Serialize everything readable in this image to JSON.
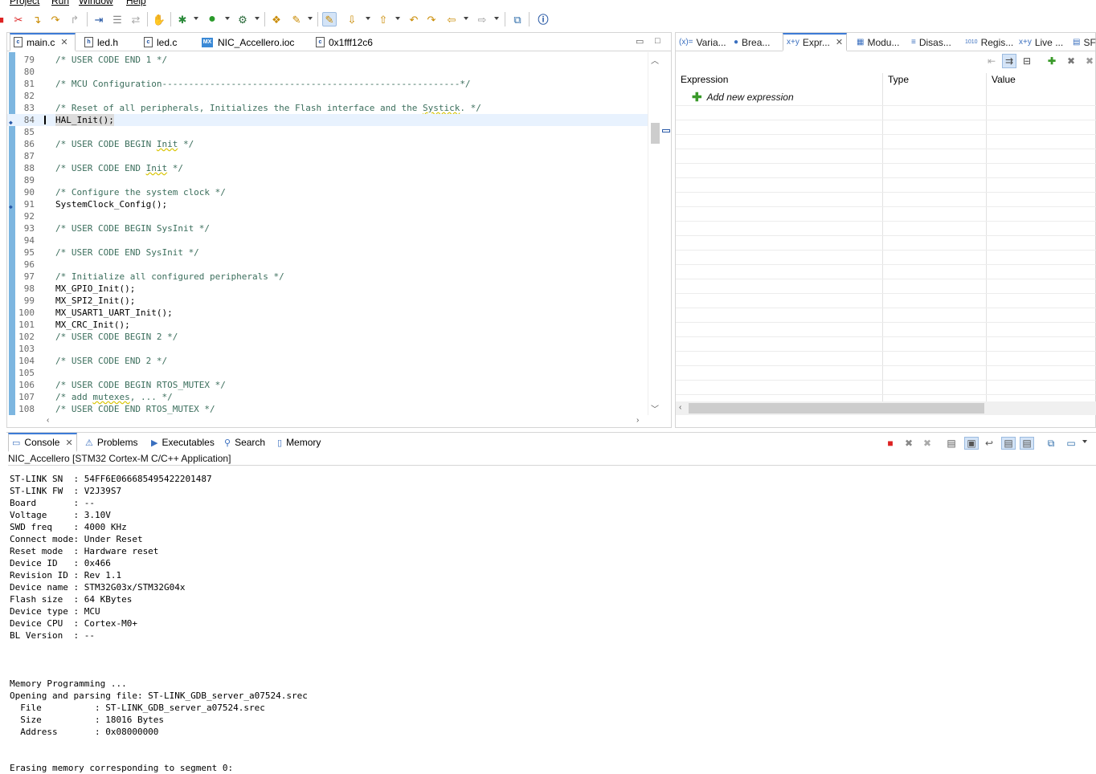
{
  "menu": {
    "items": [
      "Project",
      "Run",
      "Window",
      "Help"
    ]
  },
  "toolbar": {
    "icons": [
      "terminate-icon",
      "disconnect-icon",
      "step-return-icon",
      "use-step-filters-icon",
      "step-into-icon",
      "drop-to-frame-icon",
      "debug-icon",
      "run-icon",
      "external-tools-icon",
      "open-type-icon",
      "build-icon",
      "toggle-mark-occurrences-icon",
      "next-annotation-icon",
      "previous-annotation-icon",
      "last-edit-location-icon",
      "back-icon",
      "forward-icon",
      "open-perspective-icon",
      "info-icon"
    ]
  },
  "editor": {
    "tabs": [
      {
        "label": "main.c",
        "icon": "c"
      },
      {
        "label": "led.h",
        "icon": "h"
      },
      {
        "label": "led.c",
        "icon": "c"
      },
      {
        "label": "NIC_Accellero.ioc",
        "icon": "MX"
      },
      {
        "label": "0x1fff12c6",
        "icon": "c"
      }
    ],
    "lines": [
      {
        "n": "79",
        "t": "/* USER CODE END 1 */"
      },
      {
        "n": "80",
        "t": ""
      },
      {
        "n": "81",
        "t": "/* MCU Configuration--------------------------------------------------------*/"
      },
      {
        "n": "82",
        "t": ""
      },
      {
        "n": "83",
        "t": "/* Reset of all peripherals, Initializes the Flash interface and the Systick. */"
      },
      {
        "n": "84",
        "t": "HAL_Init();"
      },
      {
        "n": "85",
        "t": ""
      },
      {
        "n": "86",
        "t": "/* USER CODE BEGIN Init */"
      },
      {
        "n": "87",
        "t": ""
      },
      {
        "n": "88",
        "t": "/* USER CODE END Init */"
      },
      {
        "n": "89",
        "t": ""
      },
      {
        "n": "90",
        "t": "/* Configure the system clock */"
      },
      {
        "n": "91",
        "t": "SystemClock_Config();"
      },
      {
        "n": "92",
        "t": ""
      },
      {
        "n": "93",
        "t": "/* USER CODE BEGIN SysInit */"
      },
      {
        "n": "94",
        "t": ""
      },
      {
        "n": "95",
        "t": "/* USER CODE END SysInit */"
      },
      {
        "n": "96",
        "t": ""
      },
      {
        "n": "97",
        "t": "/* Initialize all configured peripherals */"
      },
      {
        "n": "98",
        "t": "MX_GPIO_Init();"
      },
      {
        "n": "99",
        "t": "MX_SPI2_Init();"
      },
      {
        "n": "100",
        "t": "MX_USART1_UART_Init();"
      },
      {
        "n": "101",
        "t": "MX_CRC_Init();"
      },
      {
        "n": "102",
        "t": "/* USER CODE BEGIN 2 */"
      },
      {
        "n": "103",
        "t": ""
      },
      {
        "n": "104",
        "t": "/* USER CODE END 2 */"
      },
      {
        "n": "105",
        "t": ""
      },
      {
        "n": "106",
        "t": "/* USER CODE BEGIN RTOS_MUTEX */"
      },
      {
        "n": "107",
        "t": "/* add mutexes, ... */"
      },
      {
        "n": "108",
        "t": "/* USER CODE END RTOS_MUTEX */"
      }
    ]
  },
  "expressions": {
    "tabs": [
      {
        "label": "Varia...",
        "icon": "(x)="
      },
      {
        "label": "Brea...",
        "icon": "●"
      },
      {
        "label": "Expr...",
        "icon": "x+y"
      },
      {
        "label": "Modu...",
        "icon": "▦"
      },
      {
        "label": "Disas...",
        "icon": "≡"
      },
      {
        "label": "Regis...",
        "icon": "1010"
      },
      {
        "label": "Live ...",
        "icon": "x+y"
      },
      {
        "label": "SF",
        "icon": "▤"
      }
    ],
    "columns": [
      "Expression",
      "Type",
      "Value"
    ],
    "add_label": "Add new expression"
  },
  "console": {
    "tabs": [
      {
        "label": "Console",
        "icon": "▭"
      },
      {
        "label": "Problems",
        "icon": "⚠"
      },
      {
        "label": "Executables",
        "icon": "▶"
      },
      {
        "label": "Search",
        "icon": "⚲"
      },
      {
        "label": "Memory",
        "icon": "▯"
      }
    ],
    "title": "NIC_Accellero [STM32 Cortex-M C/C++ Application]",
    "lines": [
      "ST-LINK SN  : 54FF6E066685495422201487",
      "ST-LINK FW  : V2J39S7",
      "Board       : --",
      "Voltage     : 3.10V",
      "SWD freq    : 4000 KHz",
      "Connect mode: Under Reset",
      "Reset mode  : Hardware reset",
      "Device ID   : 0x466",
      "Revision ID : Rev 1.1",
      "Device name : STM32G03x/STM32G04x",
      "Flash size  : 64 KBytes",
      "Device type : MCU",
      "Device CPU  : Cortex-M0+",
      "BL Version  : --",
      "",
      "",
      "",
      "Memory Programming ...",
      "Opening and parsing file: ST-LINK_GDB_server_a07524.srec",
      "  File          : ST-LINK_GDB_server_a07524.srec",
      "  Size          : 18016 Bytes",
      "  Address       : 0x08000000",
      "",
      "",
      "Erasing memory corresponding to segment 0:"
    ]
  }
}
